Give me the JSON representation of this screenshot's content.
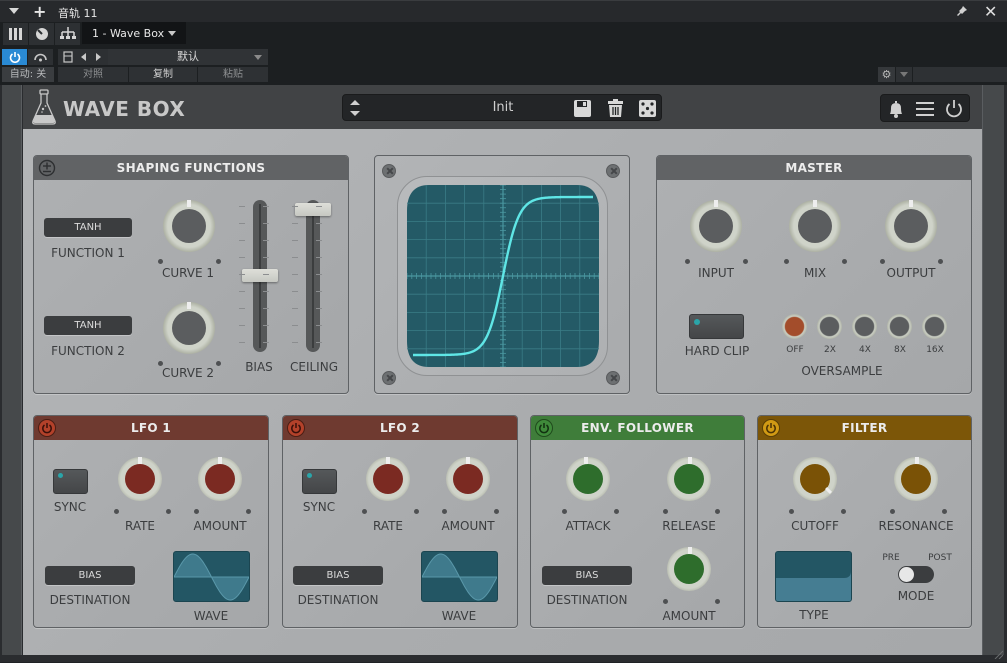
{
  "host": {
    "track_name": "音轨 11",
    "plugin_selector": "1 - Wave Box",
    "preset_name": "默认",
    "auto_label": "自动: 关",
    "compare_label": "对照",
    "copy_label": "复制",
    "paste_label": "粘贴",
    "power_active": true,
    "accent_color": "#2a8ad4"
  },
  "plugin": {
    "brand": "WAVE BOX",
    "preset": "Init",
    "icons": [
      "preset-arrows-icon",
      "save-icon",
      "trash-icon",
      "dice-icon",
      "bell-icon",
      "menu-icon",
      "power-icon"
    ]
  },
  "shaping": {
    "title": "SHAPING FUNCTIONS",
    "function1": {
      "value": "TANH",
      "label": "FUNCTION 1"
    },
    "function2": {
      "value": "TANH",
      "label": "FUNCTION 2"
    },
    "curve1": {
      "label": "CURVE 1",
      "value": 0.5
    },
    "curve2": {
      "label": "CURVE 2",
      "value": 0.5
    },
    "bias": {
      "label": "BIAS",
      "value": 0.5
    },
    "ceiling": {
      "label": "CEILING",
      "value": 1.0
    }
  },
  "scope": {
    "curve": "tanh",
    "trace_color": "#5fe6e6",
    "screen_color": "#245a66"
  },
  "master": {
    "title": "MASTER",
    "input": {
      "label": "INPUT",
      "value": 0.5
    },
    "mix": {
      "label": "MIX",
      "value": 0.5
    },
    "output": {
      "label": "OUTPUT",
      "value": 0.5
    },
    "hard_clip": {
      "label": "HARD CLIP",
      "on": true
    },
    "oversample": {
      "label": "OVERSAMPLE",
      "options": [
        "OFF",
        "2X",
        "4X",
        "8X",
        "16X"
      ],
      "selected": "OFF"
    }
  },
  "lfo1": {
    "title": "LFO 1",
    "color": "#6f3a30",
    "sync": "SYNC",
    "rate": {
      "label": "RATE",
      "value": 0.5
    },
    "amount": {
      "label": "AMOUNT",
      "value": 0.5
    },
    "destination": {
      "value": "BIAS",
      "label": "DESTINATION"
    },
    "wave_label": "WAVE",
    "wave": "sine"
  },
  "lfo2": {
    "title": "LFO 2",
    "color": "#6f3a30",
    "sync": "SYNC",
    "rate": {
      "label": "RATE",
      "value": 0.5
    },
    "amount": {
      "label": "AMOUNT",
      "value": 0.5
    },
    "destination": {
      "value": "BIAS",
      "label": "DESTINATION"
    },
    "wave_label": "WAVE",
    "wave": "sine"
  },
  "env": {
    "title": "ENV. FOLLOWER",
    "color": "#3f7d3a",
    "attack": {
      "label": "ATTACK",
      "value": 0.45
    },
    "release": {
      "label": "RELEASE",
      "value": 0.52
    },
    "amount": {
      "label": "AMOUNT",
      "value": 0.52
    },
    "destination": {
      "value": "BIAS",
      "label": "DESTINATION"
    }
  },
  "filter": {
    "title": "FILTER",
    "color": "#7c5608",
    "cutoff": {
      "label": "CUTOFF",
      "value": 0.88
    },
    "resonance": {
      "label": "RESONANCE",
      "value": 0.52
    },
    "type_label": "TYPE",
    "mode_label": "MODE",
    "mode_pre": "PRE",
    "mode_post": "POST",
    "mode": "PRE"
  }
}
